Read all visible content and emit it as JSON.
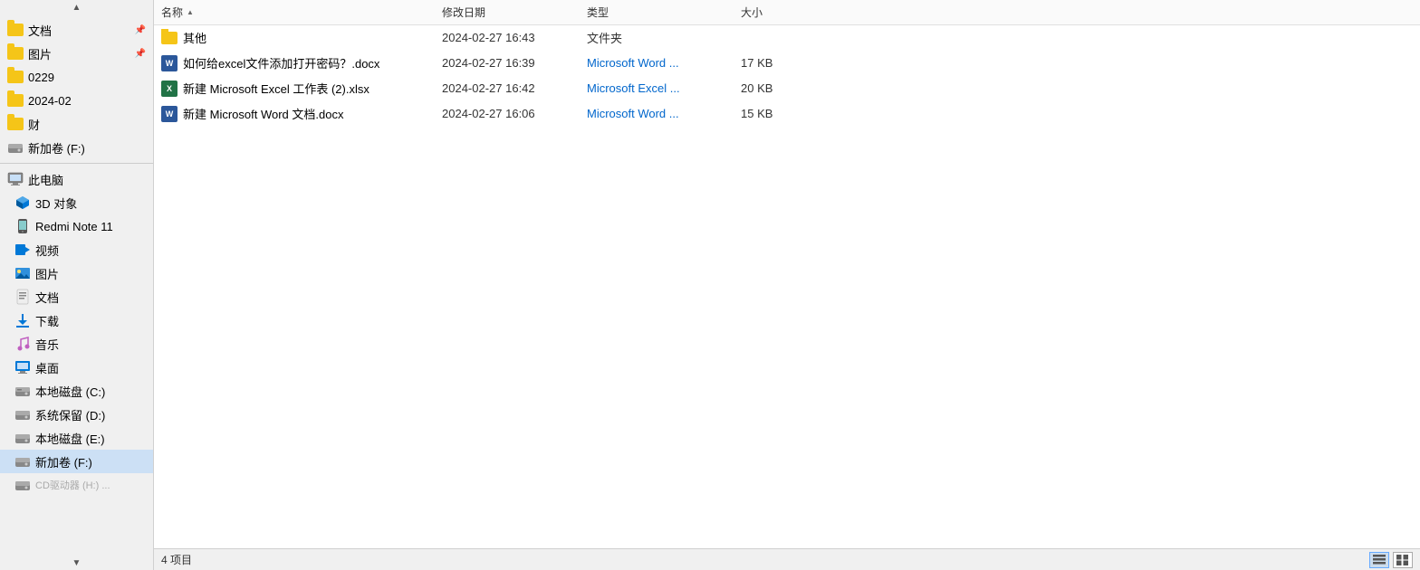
{
  "sidebar": {
    "items": [
      {
        "id": "docs",
        "label": "文档",
        "icon": "folder",
        "pinned": true,
        "indent": 0
      },
      {
        "id": "pictures",
        "label": "图片",
        "icon": "folder",
        "pinned": true,
        "indent": 0
      },
      {
        "id": "0229",
        "label": "0229",
        "icon": "folder",
        "pinned": false,
        "indent": 0
      },
      {
        "id": "2024-02",
        "label": "2024-02",
        "icon": "folder",
        "pinned": false,
        "indent": 0
      },
      {
        "id": "cai",
        "label": "财",
        "icon": "folder",
        "pinned": false,
        "indent": 0
      },
      {
        "id": "newvol-f",
        "label": "新加卷 (F:)",
        "icon": "drive",
        "pinned": false,
        "indent": 0
      },
      {
        "id": "this-pc",
        "label": "此电脑",
        "icon": "computer",
        "pinned": false,
        "indent": 0
      },
      {
        "id": "3d",
        "label": "3D 对象",
        "icon": "3d",
        "pinned": false,
        "indent": 1
      },
      {
        "id": "redmi",
        "label": "Redmi Note 11",
        "icon": "phone",
        "pinned": false,
        "indent": 1
      },
      {
        "id": "video",
        "label": "视频",
        "icon": "video",
        "pinned": false,
        "indent": 1
      },
      {
        "id": "pic2",
        "label": "图片",
        "icon": "photo",
        "pinned": false,
        "indent": 1
      },
      {
        "id": "doc2",
        "label": "文档",
        "icon": "doc",
        "pinned": false,
        "indent": 1
      },
      {
        "id": "download",
        "label": "下载",
        "icon": "download",
        "pinned": false,
        "indent": 1
      },
      {
        "id": "music",
        "label": "音乐",
        "icon": "music",
        "pinned": false,
        "indent": 1
      },
      {
        "id": "desktop",
        "label": "桌面",
        "icon": "desktop",
        "pinned": false,
        "indent": 1
      },
      {
        "id": "disk-c",
        "label": "本地磁盘 (C:)",
        "icon": "disk",
        "pinned": false,
        "indent": 1
      },
      {
        "id": "disk-d",
        "label": "系统保留 (D:)",
        "icon": "disk",
        "pinned": false,
        "indent": 1
      },
      {
        "id": "disk-e",
        "label": "本地磁盘 (E:)",
        "icon": "disk",
        "pinned": false,
        "indent": 1
      },
      {
        "id": "newvol-f2",
        "label": "新加卷 (F:)",
        "icon": "disk",
        "pinned": false,
        "indent": 1,
        "active": true
      },
      {
        "id": "more",
        "label": "CD驱动器 (H:) ...",
        "icon": "disk",
        "pinned": false,
        "indent": 1
      }
    ],
    "scroll_up_visible": true,
    "scroll_down_visible": true
  },
  "columns": {
    "name": {
      "label": "名称",
      "sort_arrow": "▲"
    },
    "date": {
      "label": "修改日期"
    },
    "type": {
      "label": "类型"
    },
    "size": {
      "label": "大小"
    }
  },
  "files": [
    {
      "id": "qita",
      "name": "其他",
      "icon": "folder",
      "date": "2024-02-27 16:43",
      "type": "文件夹",
      "type_color": "#333",
      "size": ""
    },
    {
      "id": "word1",
      "name": "如何给excel文件添加打开密码？.docx",
      "icon": "word",
      "date": "2024-02-27 16:39",
      "type": "Microsoft Word ...",
      "type_color": "#0066cc",
      "size": "17 KB"
    },
    {
      "id": "excel1",
      "name": "新建 Microsoft Excel 工作表 (2).xlsx",
      "icon": "excel",
      "date": "2024-02-27 16:42",
      "type": "Microsoft Excel ...",
      "type_color": "#0066cc",
      "size": "20 KB"
    },
    {
      "id": "word2",
      "name": "新建 Microsoft Word 文档.docx",
      "icon": "word",
      "date": "2024-02-27 16:06",
      "type": "Microsoft Word ...",
      "type_color": "#0066cc",
      "size": "15 KB"
    }
  ],
  "status": {
    "count_label": "4 项目"
  },
  "views": [
    {
      "id": "details",
      "label": "⊞",
      "active": true
    },
    {
      "id": "large",
      "label": "≡",
      "active": false
    }
  ]
}
